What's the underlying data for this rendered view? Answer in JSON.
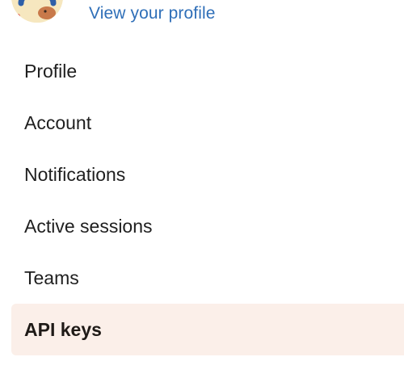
{
  "header": {
    "view_profile_label": "View your profile"
  },
  "menu": {
    "items": [
      {
        "label": "Profile",
        "active": false
      },
      {
        "label": "Account",
        "active": false
      },
      {
        "label": "Notifications",
        "active": false
      },
      {
        "label": "Active sessions",
        "active": false
      },
      {
        "label": "Teams",
        "active": false
      },
      {
        "label": "API keys",
        "active": true
      }
    ]
  },
  "colors": {
    "link": "#2f6fb8",
    "active_bg": "#fbefe9",
    "text": "#1f1f1f"
  },
  "icons": {
    "avatar": "user-avatar-illustration"
  }
}
